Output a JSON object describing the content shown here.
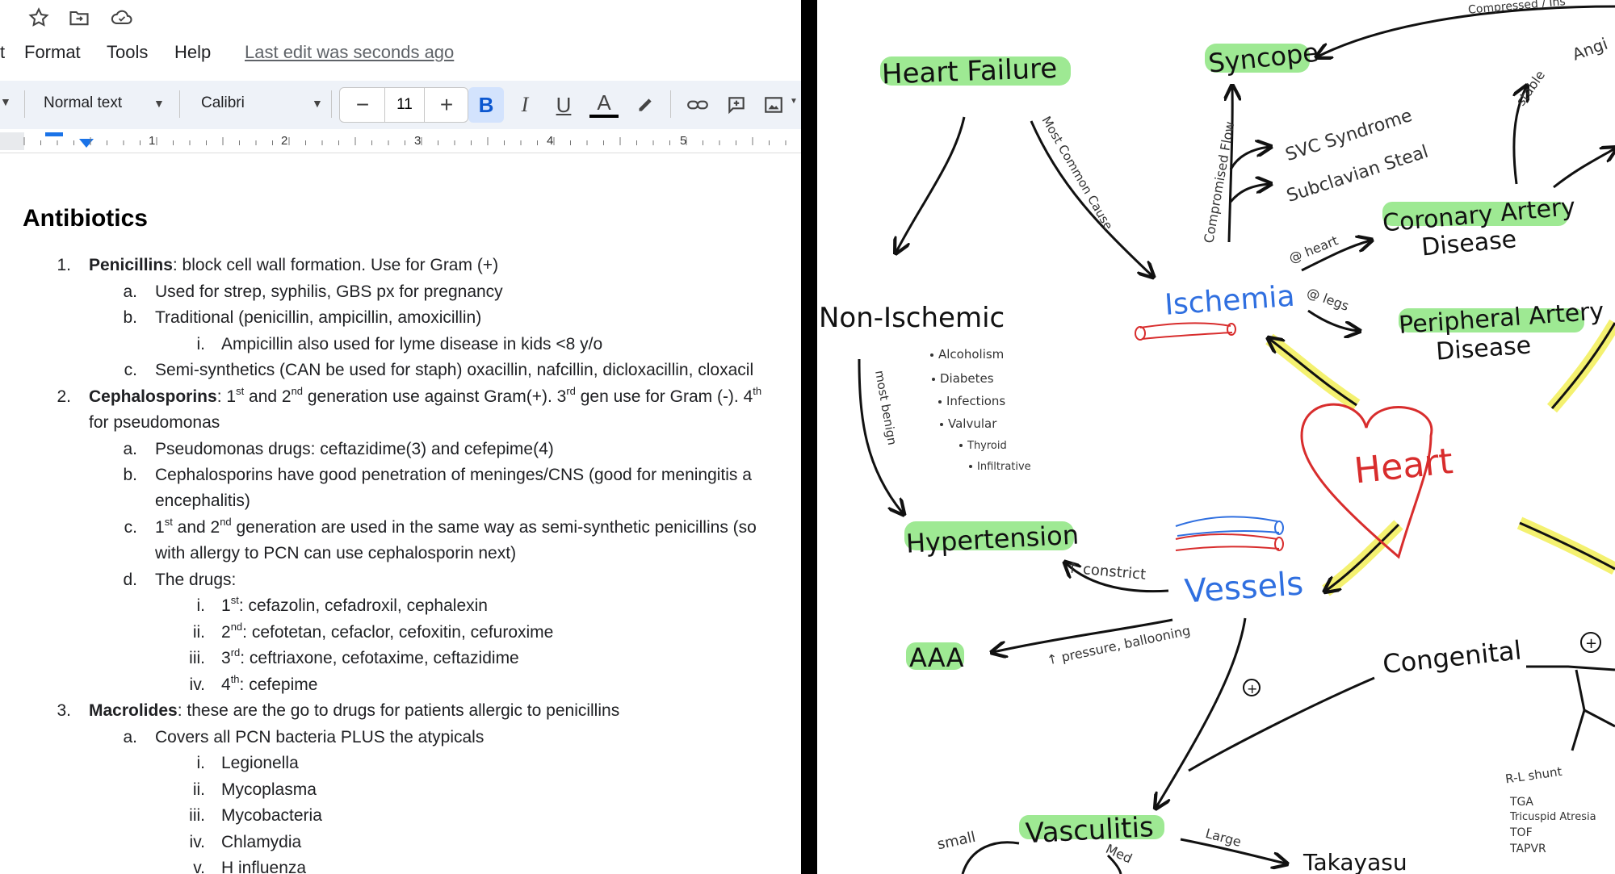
{
  "menu": {
    "partial_item": "t",
    "format": "Format",
    "tools": "Tools",
    "help": "Help",
    "last_edit": "Last edit was seconds ago"
  },
  "toolbar": {
    "style": "Normal text",
    "font": "Calibri",
    "font_size": "11",
    "bold": "B",
    "italic": "I",
    "underline": "U",
    "text_color": "A"
  },
  "ruler": {
    "marks": [
      "1",
      "2",
      "3",
      "4",
      "5"
    ]
  },
  "doc": {
    "title": "Antibiotics",
    "l1_num": "1.",
    "l1_bold": "Penicillins",
    "l1_rest": ": block cell wall formation. Use for Gram (+)",
    "l1a_num": "a.",
    "l1a": "Used for strep, syphilis, GBS px for pregnancy",
    "l1b_num": "b.",
    "l1b": "Traditional (penicillin, ampicillin, amoxicillin)",
    "l1bi_num": "i.",
    "l1bi": "Ampicillin also used for lyme disease in kids <8 y/o",
    "l1c_num": "c.",
    "l1c": "Semi-synthetics (CAN be used for staph) oxacillin, nafcillin, dicloxacillin, cloxacil",
    "l2_num": "2.",
    "l2_bold": "Cephalosporins",
    "l2_p1": ": 1",
    "l2_sup1": "st",
    "l2_p2": " and 2",
    "l2_sup2": "nd",
    "l2_p3": " generation use against Gram(+). 3",
    "l2_sup3": "rd",
    "l2_p4": " gen use for Gram (-). 4",
    "l2_sup4": "th",
    "l2_cont": "for pseudomonas",
    "l2a_num": "a.",
    "l2a": "Pseudomonas drugs: ceftazidime(3) and cefepime(4)",
    "l2b_num": "b.",
    "l2b": "Cephalosporins have good penetration of meninges/CNS (good for meningitis a",
    "l2b_cont": "encephalitis)",
    "l2c_num": "c.",
    "l2c_p1": "1",
    "l2c_sup1": "st",
    "l2c_p2": " and 2",
    "l2c_sup2": "nd",
    "l2c_p3": " generation are used in the same way as semi-synthetic penicillins (so",
    "l2c_cont": "with allergy to PCN can use cephalosporin next)",
    "l2d_num": "d.",
    "l2d": "The drugs:",
    "l2di_num": "i.",
    "l2di_p1": "1",
    "l2di_sup": "st",
    "l2di_p2": ": cefazolin, cefadroxil, cephalexin",
    "l2dii_num": "ii.",
    "l2dii_p1": "2",
    "l2dii_sup": "nd",
    "l2dii_p2": ": cefotetan, cefaclor, cefoxitin, cefuroxime",
    "l2diii_num": "iii.",
    "l2diii_p1": "3",
    "l2diii_sup": "rd",
    "l2diii_p2": ": ceftriaxone, cefotaxime, ceftazidime",
    "l2div_num": "iv.",
    "l2div_p1": "4",
    "l2div_sup": "th",
    "l2div_p2": ": cefepime",
    "l3_num": "3.",
    "l3_bold": "Macrolides",
    "l3_rest": ": these are the go to drugs for patients allergic to penicillins",
    "l3a_num": "a.",
    "l3a": "Covers all PCN bacteria PLUS the atypicals",
    "l3ai_num": "i.",
    "l3ai": "Legionella",
    "l3aii_num": "ii.",
    "l3aii": "Mycoplasma",
    "l3aiii_num": "iii.",
    "l3aiii": "Mycobacteria",
    "l3aiv_num": "iv.",
    "l3aiv": "Chlamydia",
    "l3av_num": "v.",
    "l3av": "H influenza"
  },
  "mindmap": {
    "heart": "Heart",
    "heart_failure": "Heart Failure",
    "syncope": "Syncope",
    "non_ischemic": "Non-Ischemic",
    "ischemia": "Ischemia",
    "cad": [
      "Coronary Artery",
      "Disease"
    ],
    "pad": [
      "Peripheral Artery",
      "Disease"
    ],
    "hypertension": "Hypertension",
    "vessels": "Vessels",
    "aaa": "AAA",
    "congenital": "Congenital",
    "vasculitis": "Vasculitis",
    "takayasu": "Takayasu",
    "svc": "SVC Syndrome",
    "subclavian": "Subclavian Steal",
    "compromised_flow": "Compromised Flow",
    "most_common_cause": "Most Common Cause",
    "most_benign": "most benign",
    "at_heart": "@ heart",
    "at_legs": "@ legs",
    "stable": "stable",
    "angina_partial": "Angi",
    "constrict": "↑ constrict",
    "pressure_ballooning": "↑ pressure, ballooning",
    "small": "small",
    "med": "Med",
    "large": "Large",
    "rl_shunt": "R-L shunt",
    "top_partial": "Compressed / Ins",
    "non_ischemic_causes": [
      "Alcoholism",
      "Diabetes",
      "Infections",
      "Valvular",
      "Thyroid",
      "Infiltrative"
    ],
    "congenital_list": [
      "TGA",
      "Tricuspid Atresia",
      "TOF",
      "TAPVR"
    ],
    "plus_signs": [
      "+",
      "+"
    ],
    "colors": {
      "highlight_green": "#7ee26f",
      "highlight_yellow": "#f3f060",
      "blue": "#2f6fe0",
      "red": "#d82d2d"
    }
  }
}
